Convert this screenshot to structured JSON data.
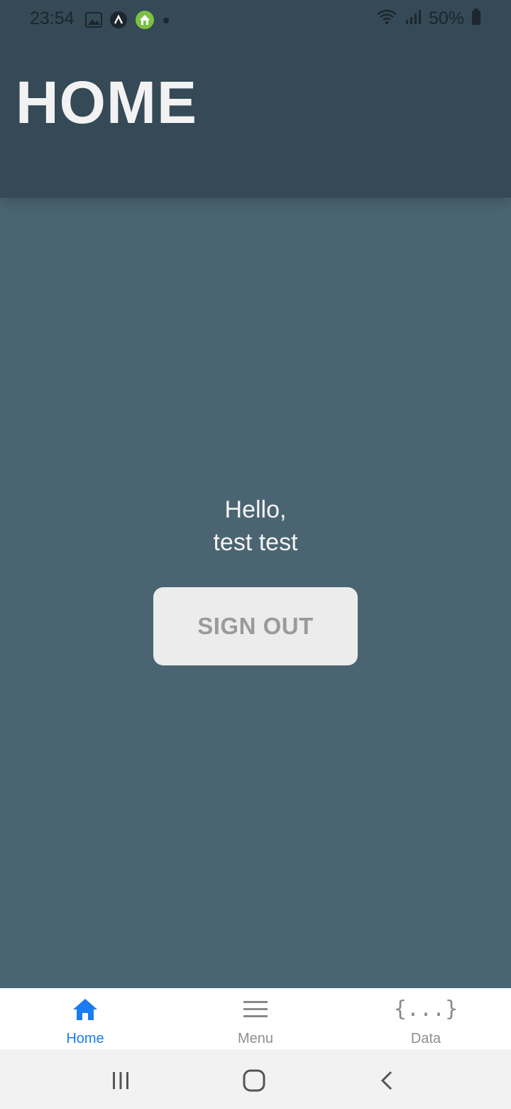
{
  "status_bar": {
    "time": "23:54",
    "battery_percent": "50%",
    "left_icons": [
      "gallery-icon",
      "app-a-icon",
      "home-app-icon",
      "dot-icon"
    ],
    "right_icons": [
      "wifi-icon",
      "signal-icon",
      "battery-icon"
    ]
  },
  "header": {
    "title": "HOME"
  },
  "main": {
    "greeting_line1": "Hello,",
    "greeting_line2": "test test",
    "signout_label": "SIGN OUT"
  },
  "tabs": [
    {
      "label": "Home",
      "icon": "home-icon",
      "active": true
    },
    {
      "label": "Menu",
      "icon": "menu-icon",
      "active": false
    },
    {
      "label": "Data",
      "icon": "braces-icon",
      "active": false
    }
  ],
  "data_icon_glyph": "{...}",
  "colors": {
    "header_bg": "#354956",
    "content_bg": "#4a6571",
    "active_tab": "#1a7cf0",
    "inactive_tab": "#8e8e8e",
    "button_bg": "#ececec"
  },
  "nav_bar": {
    "buttons": [
      "recent-apps-icon",
      "home-button-icon",
      "back-icon"
    ]
  }
}
